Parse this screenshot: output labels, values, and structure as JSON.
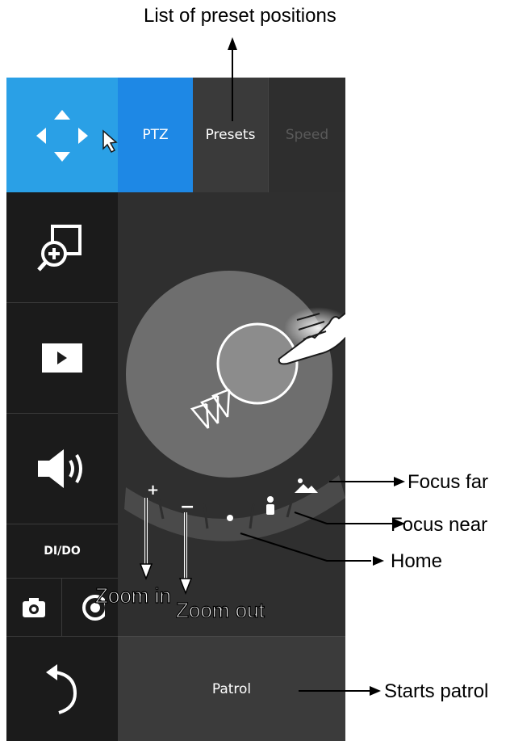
{
  "tabs": [
    {
      "label": "PTZ"
    },
    {
      "label": "Presets"
    },
    {
      "label": "Speed"
    }
  ],
  "sidebar": {
    "items": [
      {
        "icon": "pan-tilt-arrows-icon",
        "active": true
      },
      {
        "icon": "zoom-window-icon"
      },
      {
        "icon": "play-icon"
      },
      {
        "icon": "speaker-icon"
      },
      {
        "label": "DI/DO"
      },
      {
        "icon": "camera-snapshot-icon"
      },
      {
        "icon": "record-icon"
      },
      {
        "icon": "back-arrow-icon"
      }
    ]
  },
  "controls": {
    "zoom_in_symbol": "+",
    "zoom_out_symbol": "−",
    "patrol_label": "Patrol"
  },
  "annotations": {
    "presets": "List of preset positions",
    "focus_far": "Focus far",
    "focus_near": "Focus near",
    "home": "Home",
    "patrol": "Starts patrol",
    "zoom_in": "Zoom in",
    "zoom_out": "Zoom out"
  },
  "colors": {
    "accent_blue": "#2aa0e6",
    "tab_blue": "#1e88e5",
    "panel_dark": "#1b1b1b",
    "panel_mid": "#2f2f2f",
    "joystick": "#6e6e6e"
  }
}
